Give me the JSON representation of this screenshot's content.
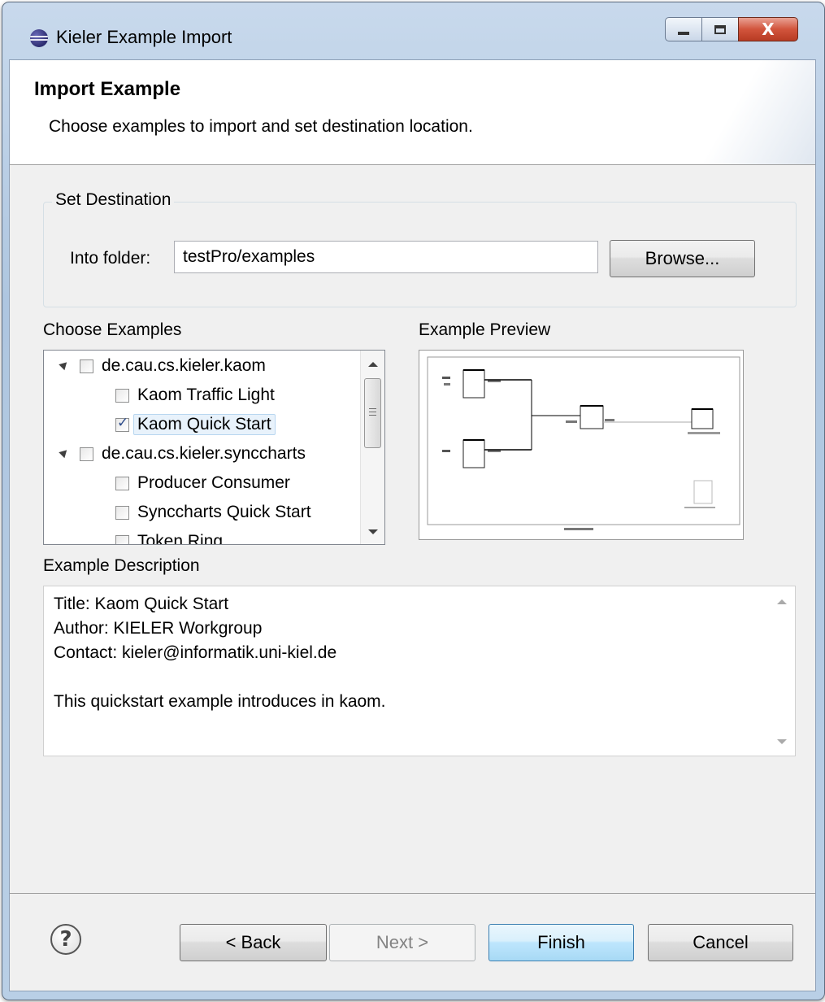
{
  "window": {
    "title": "Kieler Example Import",
    "controls": {
      "minimize_icon": "minimize-icon",
      "maximize_icon": "maximize-icon",
      "close_glyph": "X"
    }
  },
  "banner": {
    "title": "Import Example",
    "description": "Choose examples to import and set destination location."
  },
  "destination": {
    "group_label": "Set Destination",
    "folder_label": "Into folder:",
    "folder_value": "testPro/examples",
    "browse_label": "Browse..."
  },
  "examples": {
    "label": "Choose Examples",
    "tree": [
      {
        "label": "de.cau.cs.kieler.kaom",
        "expanded": true,
        "checked": false
      },
      {
        "label": "Kaom Traffic Light",
        "checked": false
      },
      {
        "label": "Kaom Quick Start",
        "checked": true,
        "selected": true
      },
      {
        "label": "de.cau.cs.kieler.synccharts",
        "expanded": true,
        "checked": false
      },
      {
        "label": "Producer Consumer",
        "checked": false
      },
      {
        "label": "Synccharts Quick Start",
        "checked": false
      },
      {
        "label": "Token Ring",
        "checked": false
      }
    ]
  },
  "preview": {
    "label": "Example Preview"
  },
  "description": {
    "label": "Example Description",
    "lines": [
      "Title: Kaom Quick Start",
      "Author: KIELER Workgroup",
      "Contact: kieler@informatik.uni-kiel.de",
      "",
      "This quickstart example introduces in kaom."
    ]
  },
  "buttons": {
    "help_glyph": "?",
    "back": "< Back",
    "next": "Next >",
    "finish": "Finish",
    "cancel": "Cancel"
  }
}
